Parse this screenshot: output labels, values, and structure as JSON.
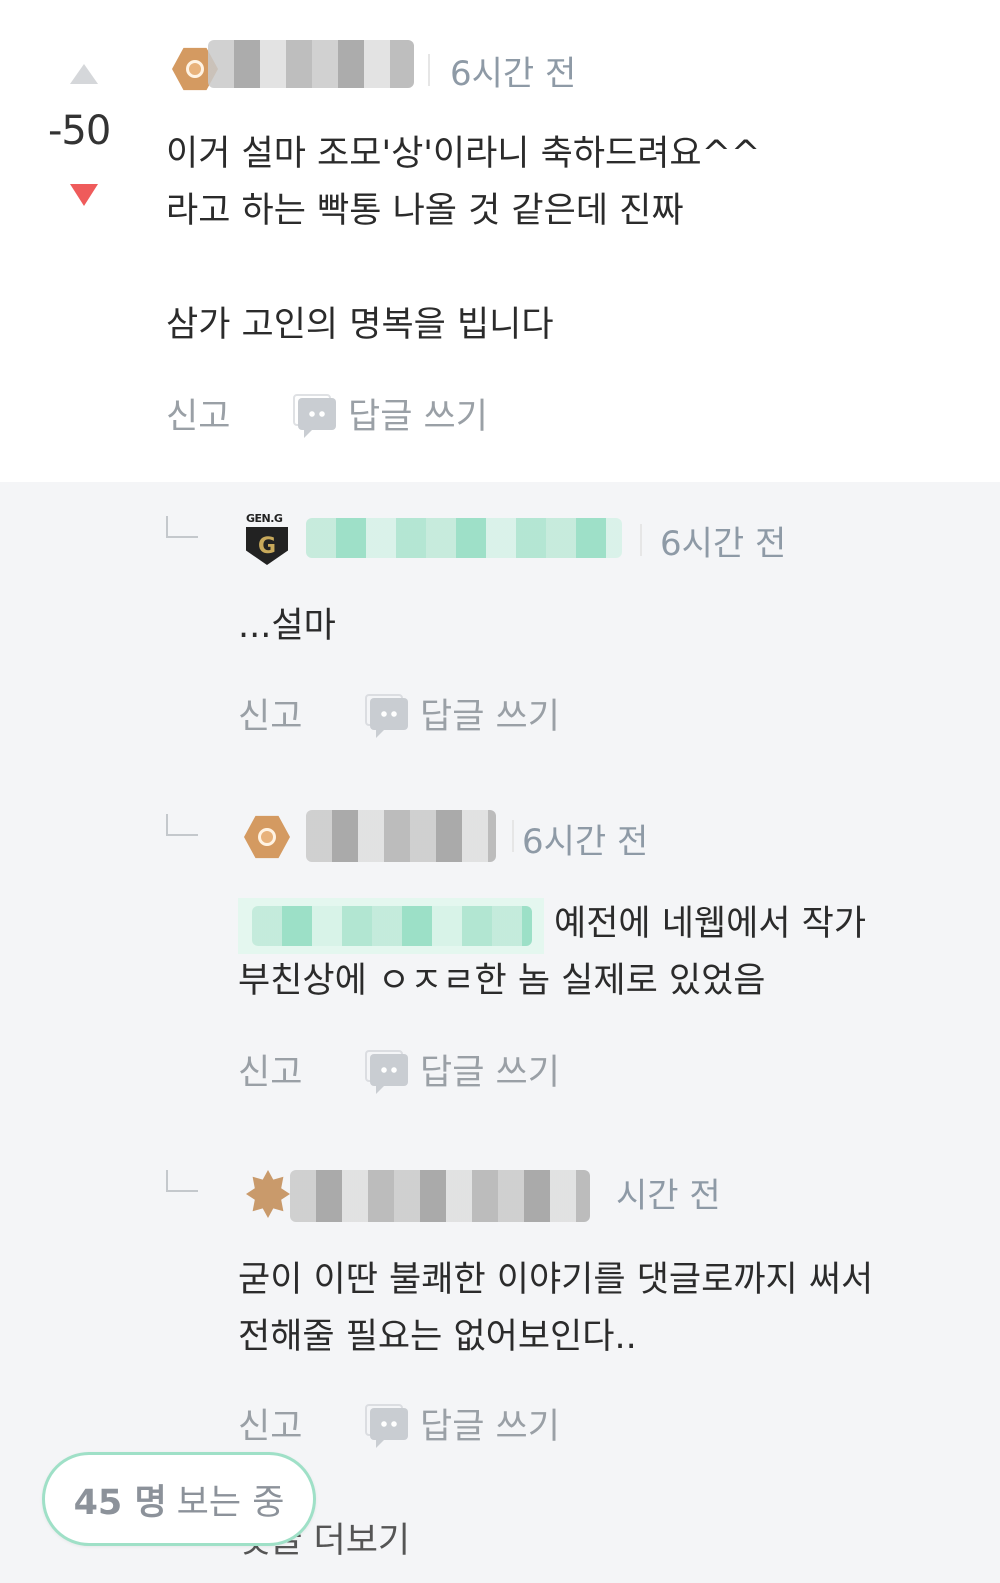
{
  "main_comment": {
    "score": "-50",
    "username": "",
    "time": "6시간 전",
    "lines": [
      "이거 설마 조모'상'이라니 축하드려요^^",
      "라고 하는 빡통 나올 것 같은데 진짜",
      "삼가 고인의 명복을 빕니다"
    ],
    "report": "신고",
    "reply": "답글 쓰기"
  },
  "replies": [
    {
      "time": "6시간 전",
      "lines": [
        "...설마"
      ],
      "report": "신고",
      "reply": "답글 쓰기",
      "badge_text": "GEN.G",
      "badge_mark": "G"
    },
    {
      "time": "6시간 전",
      "lines": [
        "예전에 네웹에서 작가",
        "부친상에 ㅇㅈㄹ한 놈 실제로 있었음"
      ],
      "report": "신고",
      "reply": "답글 쓰기"
    },
    {
      "time": "시간 전",
      "lines": [
        "굳이 이딴 불쾌한 이야기를 댓글로까지 써서",
        "전해줄 필요는 없어보인다.."
      ],
      "report": "신고",
      "reply": "답글 쓰기"
    }
  ],
  "viewers": {
    "count": "45 명",
    "label": "보는 중"
  },
  "more_comments": "댓글 더보기"
}
